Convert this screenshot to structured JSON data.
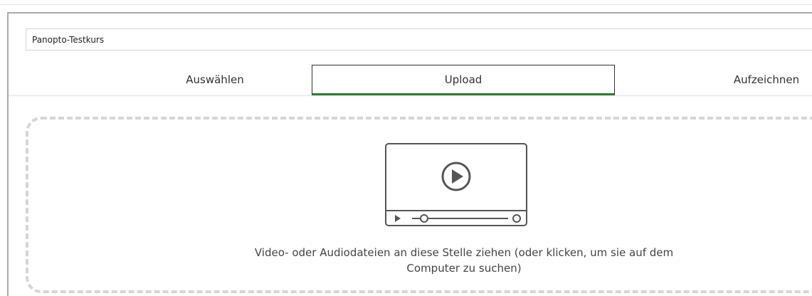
{
  "course_folder": {
    "value": "Panopto-Testkurs"
  },
  "tabs": [
    {
      "label": "Auswählen",
      "active": false
    },
    {
      "label": "Upload",
      "active": true
    },
    {
      "label": "Aufzeichnen",
      "active": false
    }
  ],
  "dropzone": {
    "icon": "video-player-icon",
    "text": "Video- oder Audiodateien an diese Stelle ziehen (oder klicken, um sie auf dem Computer zu suchen)"
  },
  "colors": {
    "active_tab_indicator": "#2e7d32",
    "dropzone_border": "#d6d6d6"
  }
}
